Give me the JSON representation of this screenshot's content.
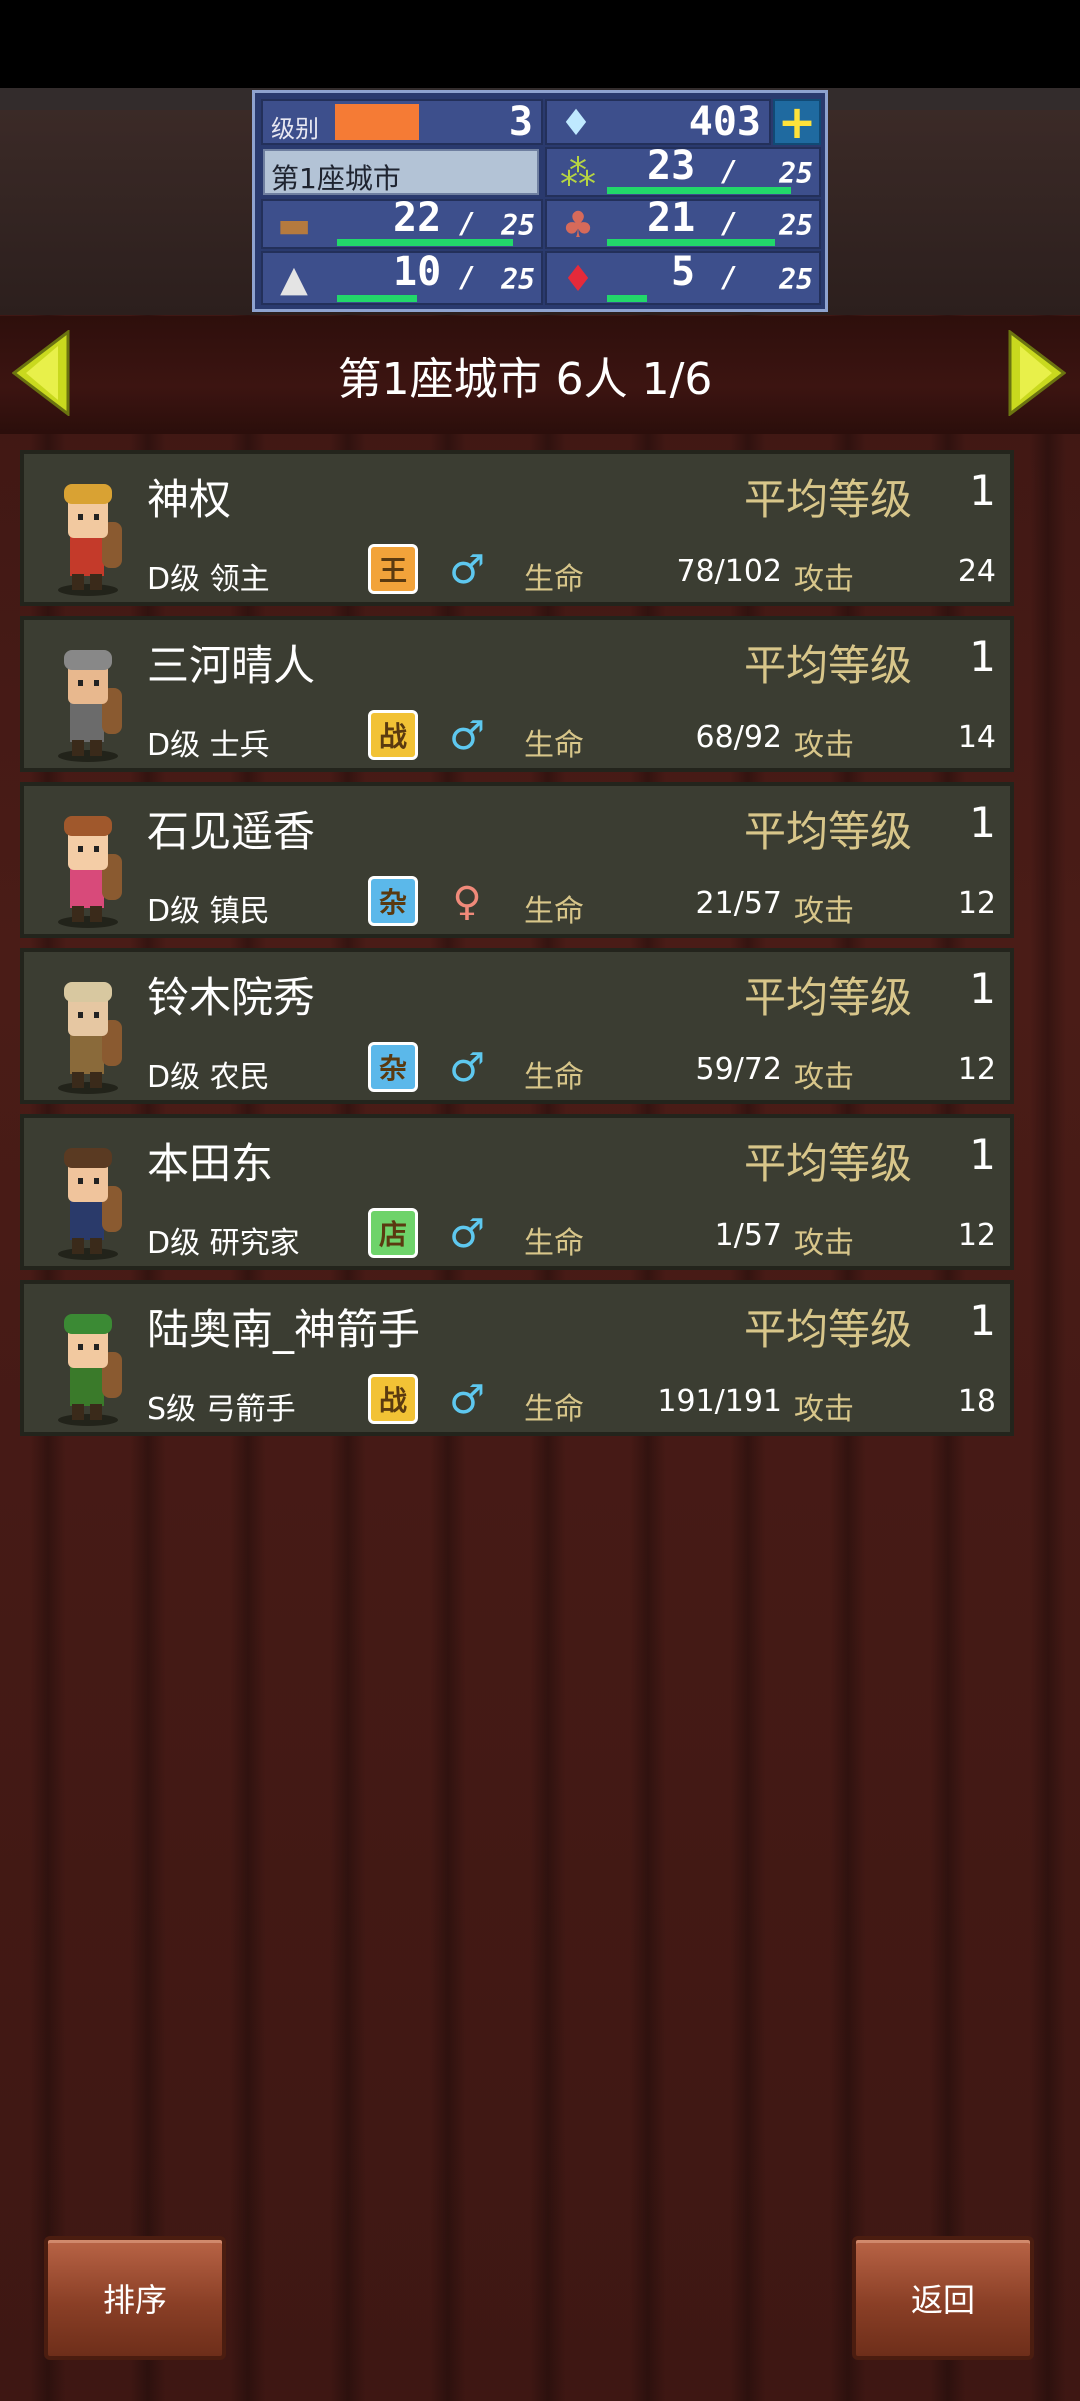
{
  "hud": {
    "level_label": "级别",
    "level_value": "3",
    "level_progress": 0.45,
    "gems": "403",
    "city_name": "第1座城市",
    "resources": [
      {
        "name": "grain",
        "icon": "grain-icon",
        "current": "23",
        "max": "25",
        "fill": 0.92
      },
      {
        "name": "wood",
        "icon": "wood-icon",
        "current": "22",
        "max": "25",
        "fill": 0.88
      },
      {
        "name": "food",
        "icon": "food-icon",
        "current": "21",
        "max": "25",
        "fill": 0.84
      },
      {
        "name": "ore",
        "icon": "ore-icon",
        "current": "10",
        "max": "25",
        "fill": 0.4
      },
      {
        "name": "mana",
        "icon": "red-gem-icon",
        "current": "5",
        "max": "25",
        "fill": 0.2
      }
    ],
    "slash": "/"
  },
  "header": {
    "title": "第1座城市  6人  1/6"
  },
  "labels": {
    "avg_level": "平均等级",
    "hp": "生命",
    "attack": "攻击"
  },
  "members": [
    {
      "name": "神权",
      "level": "1",
      "rank": "D级 领主",
      "badge": "王",
      "badge_color": "#f2a33a",
      "sex": "male",
      "hp": "78/102",
      "attack": "24"
    },
    {
      "name": "三河晴人",
      "level": "1",
      "rank": "D级 士兵",
      "badge": "战",
      "badge_color": "#f2c235",
      "sex": "male",
      "hp": "68/92",
      "attack": "14"
    },
    {
      "name": "石见遥香",
      "level": "1",
      "rank": "D级 镇民",
      "badge": "杂",
      "badge_color": "#5bb8ea",
      "sex": "female",
      "hp": "21/57",
      "attack": "12"
    },
    {
      "name": "铃木院秀",
      "level": "1",
      "rank": "D级 农民",
      "badge": "杂",
      "badge_color": "#5bb8ea",
      "sex": "male",
      "hp": "59/72",
      "attack": "12"
    },
    {
      "name": "本田东",
      "level": "1",
      "rank": "D级 研究家",
      "badge": "店",
      "badge_color": "#6ed36a",
      "sex": "male",
      "hp": "1/57",
      "attack": "12"
    },
    {
      "name": "陆奥南_神箭手",
      "level": "1",
      "rank": "S级 弓箭手",
      "badge": "战",
      "badge_color": "#f2c235",
      "sex": "male",
      "hp": "191/191",
      "attack": "18"
    }
  ],
  "buttons": {
    "sort": "排序",
    "back": "返回"
  }
}
